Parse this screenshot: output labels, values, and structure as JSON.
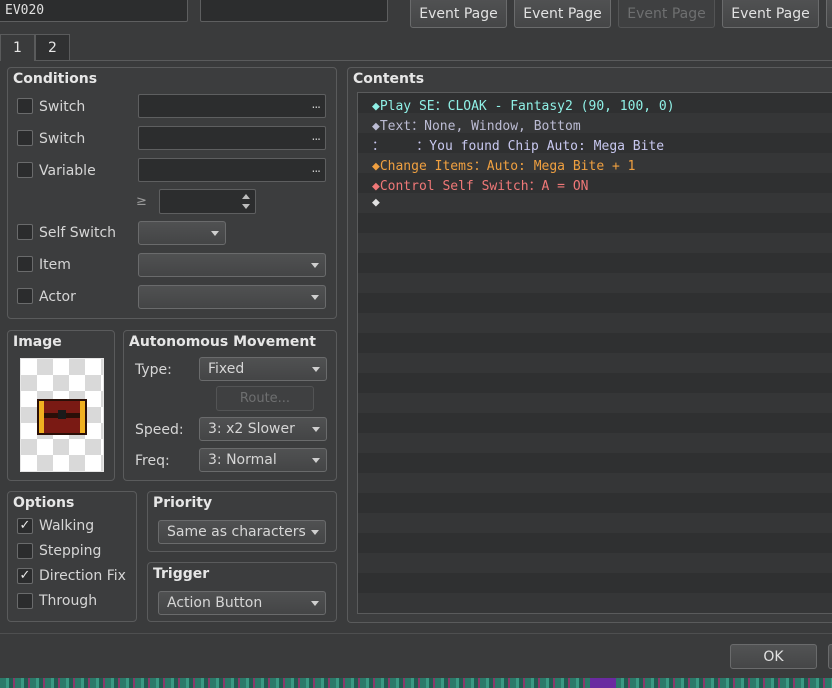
{
  "top": {
    "event_id": "EV020",
    "event_name": "",
    "page_buttons": [
      {
        "label": "Event Page",
        "enabled": true
      },
      {
        "label": "Event Page",
        "enabled": true
      },
      {
        "label": "Event Page",
        "enabled": false
      },
      {
        "label": "Event Page",
        "enabled": true
      }
    ]
  },
  "tabs": [
    "1",
    "2"
  ],
  "conditions": {
    "title": "Conditions",
    "rows": [
      {
        "label": "Switch",
        "checked": false
      },
      {
        "label": "Switch",
        "checked": false
      },
      {
        "label": "Variable",
        "checked": false
      },
      {
        "label": "Self Switch",
        "checked": false
      },
      {
        "label": "Item",
        "checked": false
      },
      {
        "label": "Actor",
        "checked": false
      }
    ],
    "ge_symbol": "≥",
    "ellipsis": "..."
  },
  "image": {
    "title": "Image"
  },
  "autonomous": {
    "title": "Autonomous Movement",
    "type_label": "Type:",
    "type_value": "Fixed",
    "route_label": "Route...",
    "speed_label": "Speed:",
    "speed_value": "3: x2 Slower",
    "freq_label": "Freq:",
    "freq_value": "3: Normal"
  },
  "options": {
    "title": "Options",
    "items": [
      {
        "label": "Walking",
        "checked": true
      },
      {
        "label": "Stepping",
        "checked": false
      },
      {
        "label": "Direction Fix",
        "checked": true
      },
      {
        "label": "Through",
        "checked": false
      }
    ],
    "check_glyph": "✓"
  },
  "priority": {
    "title": "Priority",
    "value": "Same as characters"
  },
  "trigger": {
    "title": "Trigger",
    "value": "Action Button"
  },
  "contents": {
    "title": "Contents",
    "lines": [
      {
        "text": "◆Play SE：CLOAK - Fantasy2 (90, 100, 0)",
        "color": "#8ff0e6"
      },
      {
        "text": "◆Text：None, Window, Bottom",
        "color": "#bcbcd4"
      },
      {
        "text": "：    ：You found Chip Auto: Mega Bite",
        "color": "#c8c8f0"
      },
      {
        "text": "◆Change Items：Auto: Mega Bite + 1",
        "color": "#f0a040"
      },
      {
        "text": "◆Control Self Switch：A = ON",
        "color": "#f07878"
      },
      {
        "text": "◆",
        "color": "#e0e0e0"
      }
    ]
  },
  "footer": {
    "ok_label": "OK"
  }
}
